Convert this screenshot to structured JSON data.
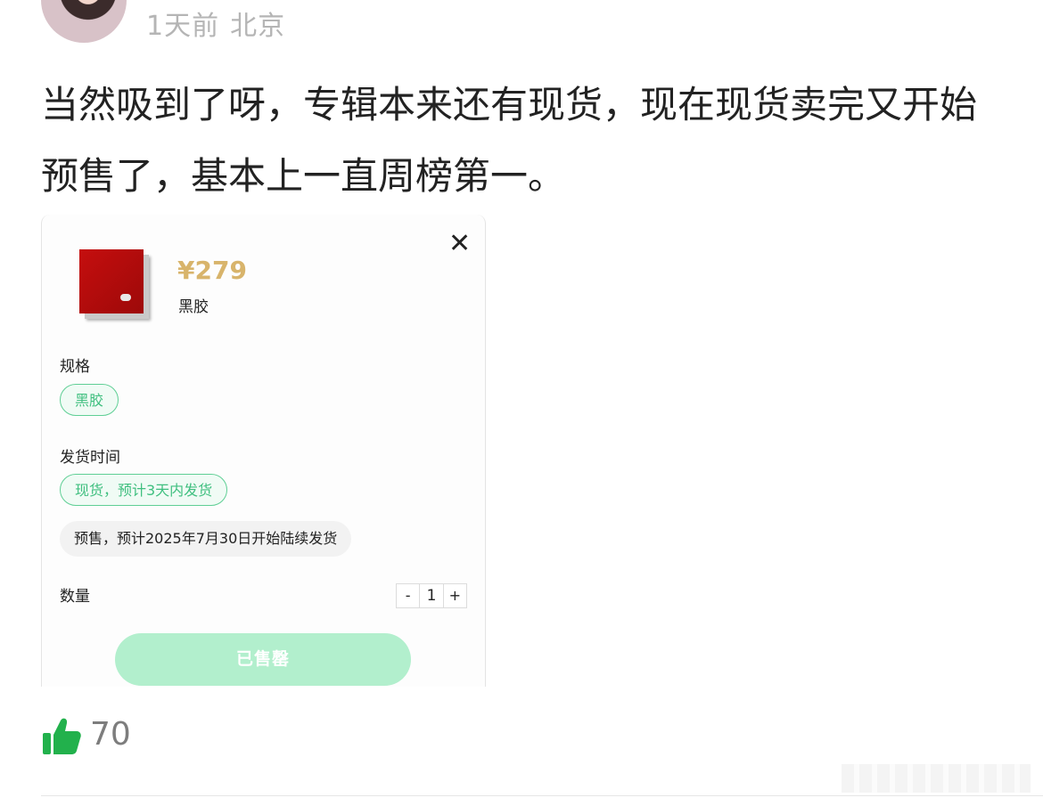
{
  "header": {
    "time": "1天前",
    "location": "北京"
  },
  "comment": {
    "text": "当然吸到了呀，专辑本来还有现货，现在现货卖完又开始预售了，基本上一直周榜第一。"
  },
  "card": {
    "close_symbol": "✕",
    "product": {
      "price": "¥279",
      "name": "黑胶"
    },
    "spec": {
      "label": "规格",
      "options": [
        "黑胶"
      ],
      "selected": "黑胶"
    },
    "shipping": {
      "label": "发货时间",
      "options": [
        "现货，预计3天内发货",
        "预售，预计2025年7月30日开始陆续发货"
      ],
      "selected": "现货，预计3天内发货"
    },
    "quantity": {
      "label": "数量",
      "minus": "-",
      "value": "1",
      "plus": "+"
    },
    "action_button": "已售罄"
  },
  "like": {
    "count": "70",
    "icon": "thumbs-up-icon",
    "color": "#22b14c"
  },
  "colors": {
    "accent_green": "#3fbf7f",
    "price_gold": "#d8b46b",
    "soldout_bg": "#b2efcd"
  }
}
